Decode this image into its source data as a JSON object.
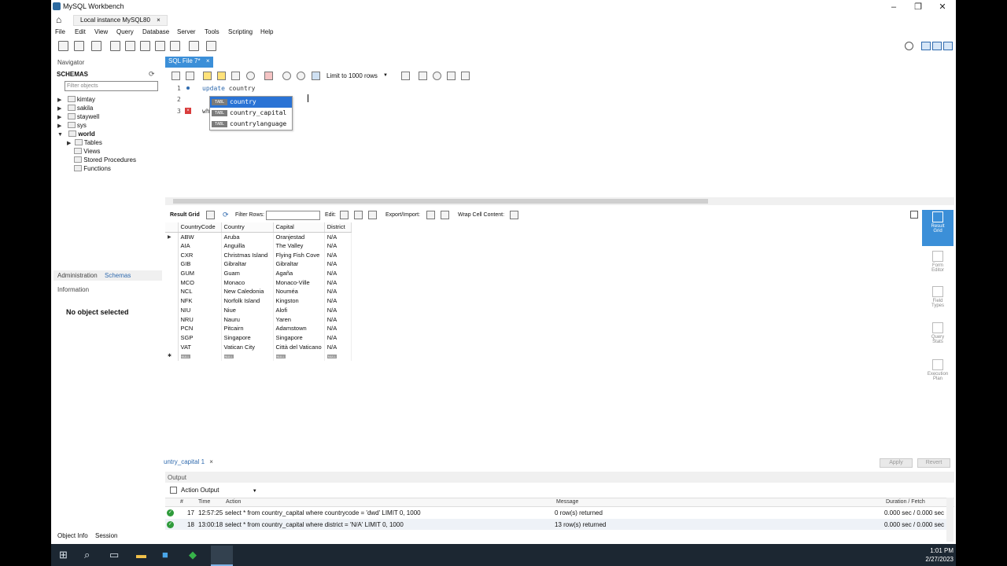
{
  "window": {
    "title": "MySQL Workbench"
  },
  "connection_tab": {
    "label": "Local instance MySQL80"
  },
  "menu": [
    "File",
    "Edit",
    "View",
    "Query",
    "Database",
    "Server",
    "Tools",
    "Scripting",
    "Help"
  ],
  "navigator": {
    "title": "Navigator",
    "schemas_label": "SCHEMAS",
    "filter_placeholder": "Filter objects",
    "schemas": [
      "kimtay",
      "sakila",
      "staywell",
      "sys",
      "world"
    ],
    "world_children": [
      "Tables",
      "Views",
      "Stored Procedures",
      "Functions"
    ],
    "tabs": [
      "Administration",
      "Schemas"
    ],
    "information_label": "Information",
    "no_selection": "No object selected",
    "bottom_tabs": [
      "Object Info",
      "Session"
    ]
  },
  "editor": {
    "tab_label": "SQL File 7*",
    "limit": "Limit to 1000 rows",
    "line_numbers": [
      "1",
      "2",
      "3"
    ],
    "line1_keyword": "update",
    "line1_rest": " country",
    "line3_text": "wh",
    "autocomplete": [
      {
        "badge": "TABL",
        "text": "country"
      },
      {
        "badge": "TABL",
        "text": "country_capital"
      },
      {
        "badge": "TABL",
        "text": "countrylanguage"
      }
    ]
  },
  "result_toolbar": {
    "result_grid": "Result Grid",
    "filter_rows": "Filter Rows:",
    "edit": "Edit:",
    "export_import": "Export/Import:",
    "wrap": "Wrap Cell Content:"
  },
  "grid": {
    "columns": [
      "CountryCode",
      "Country",
      "Capital",
      "District"
    ],
    "rows": [
      [
        "ABW",
        "Aruba",
        "Oranjestad",
        "N/A"
      ],
      [
        "AIA",
        "Anguilla",
        "The Valley",
        "N/A"
      ],
      [
        "CXR",
        "Christmas Island",
        "Flying Fish Cove",
        "N/A"
      ],
      [
        "GIB",
        "Gibraltar",
        "Gibraltar",
        "N/A"
      ],
      [
        "GUM",
        "Guam",
        "Agaña",
        "N/A"
      ],
      [
        "MCO",
        "Monaco",
        "Monaco-Ville",
        "N/A"
      ],
      [
        "NCL",
        "New Caledonia",
        "Nouméa",
        "N/A"
      ],
      [
        "NFK",
        "Norfolk Island",
        "Kingston",
        "N/A"
      ],
      [
        "NIU",
        "Niue",
        "Alofi",
        "N/A"
      ],
      [
        "NRU",
        "Nauru",
        "Yaren",
        "N/A"
      ],
      [
        "PCN",
        "Pitcairn",
        "Adamstown",
        "N/A"
      ],
      [
        "SGP",
        "Singapore",
        "Singapore",
        "N/A"
      ],
      [
        "VAT",
        "Vatican City",
        "Città del Vaticano",
        "N/A"
      ]
    ],
    "null_label": "NULL"
  },
  "side_panel": [
    {
      "label1": "Result",
      "label2": "Grid"
    },
    {
      "label1": "Form",
      "label2": "Editor"
    },
    {
      "label1": "Field",
      "label2": "Types"
    },
    {
      "label1": "Query",
      "label2": "Stats"
    },
    {
      "label1": "Execution",
      "label2": "Plan"
    }
  ],
  "result_tab": {
    "label": "untry_capital 1"
  },
  "buttons": {
    "apply": "Apply",
    "revert": "Revert"
  },
  "output": {
    "title": "Output",
    "selector": "Action Output",
    "headers": {
      "num": "#",
      "time": "Time",
      "action": "Action",
      "message": "Message",
      "duration": "Duration / Fetch"
    },
    "rows": [
      {
        "num": "17",
        "time": "12:57:25",
        "action": "select * from country_capital where countrycode = 'dwd' LIMIT 0, 1000",
        "message": "0 row(s) returned",
        "duration": "0.000 sec / 0.000 sec"
      },
      {
        "num": "18",
        "time": "13:00:18",
        "action": "select * from country_capital where district = 'N/A' LIMIT 0, 1000",
        "message": "13 row(s) returned",
        "duration": "0.000 sec / 0.000 sec"
      }
    ]
  },
  "taskbar": {
    "time": "1:01 PM",
    "date": "2/27/2023"
  }
}
